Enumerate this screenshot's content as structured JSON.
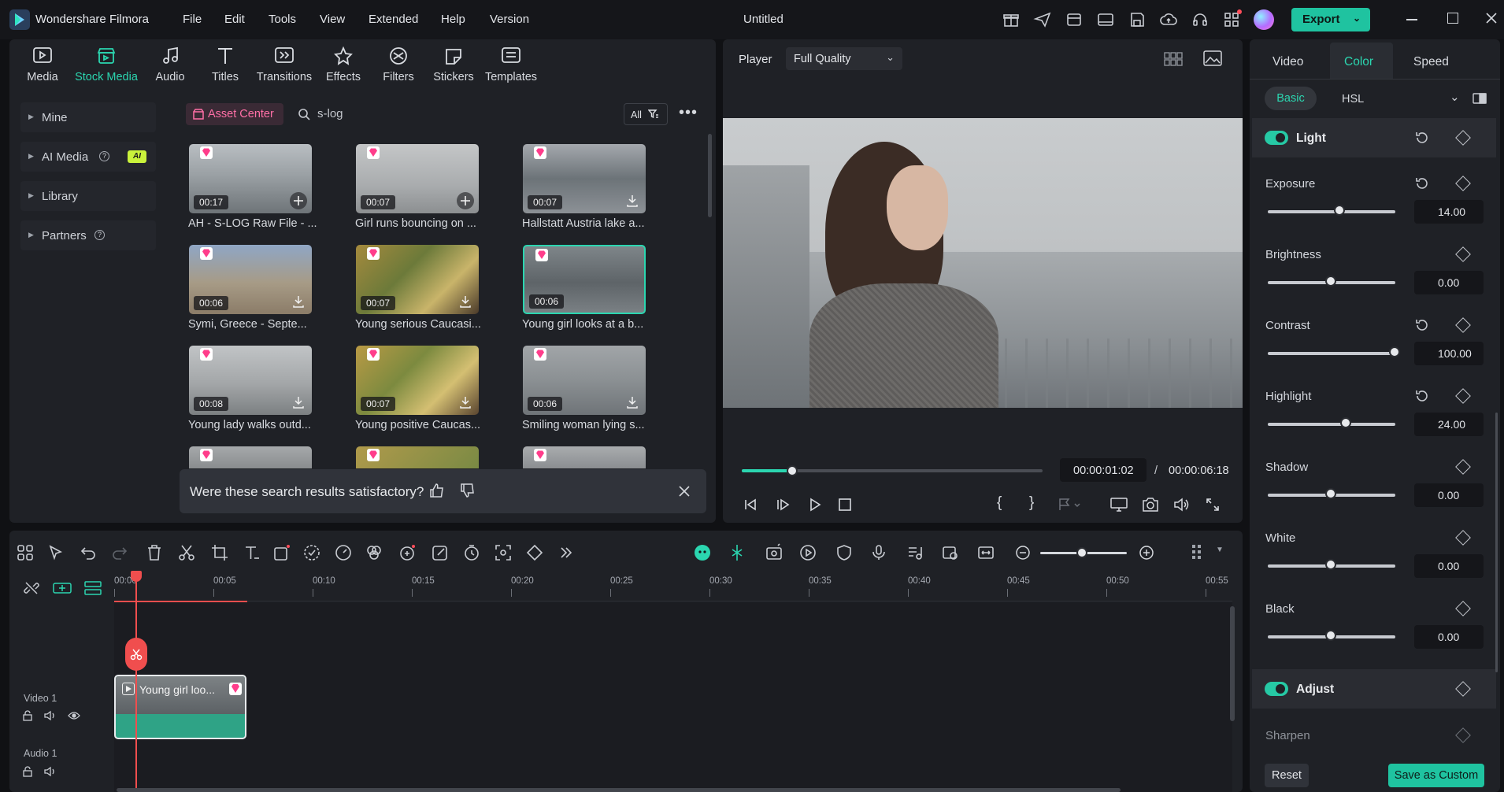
{
  "app": {
    "title": "Wondershare Filmora",
    "project_title": "Untitled",
    "menu": [
      "File",
      "Edit",
      "Tools",
      "View",
      "Extended",
      "Help",
      "Version"
    ],
    "export_label": "Export"
  },
  "media_tabs": [
    {
      "label": "Media",
      "icon": "media-icon"
    },
    {
      "label": "Stock Media",
      "icon": "stock-media-icon"
    },
    {
      "label": "Audio",
      "icon": "audio-icon"
    },
    {
      "label": "Titles",
      "icon": "titles-icon"
    },
    {
      "label": "Transitions",
      "icon": "transitions-icon"
    },
    {
      "label": "Effects",
      "icon": "effects-icon"
    },
    {
      "label": "Filters",
      "icon": "filters-icon"
    },
    {
      "label": "Stickers",
      "icon": "stickers-icon"
    },
    {
      "label": "Templates",
      "icon": "templates-icon"
    }
  ],
  "sidebar": {
    "items": [
      {
        "label": "Mine"
      },
      {
        "label": "AI Media",
        "badge": "AI"
      },
      {
        "label": "Library"
      },
      {
        "label": "Partners"
      }
    ]
  },
  "browser": {
    "asset_center_label": "Asset Center",
    "search_value": "s-log",
    "filter_label": "All",
    "items": [
      {
        "title": "AH - S-LOG Raw File - ...",
        "duration": "00:17",
        "action": "add"
      },
      {
        "title": "Girl runs bouncing on ...",
        "duration": "00:07",
        "action": "add"
      },
      {
        "title": "Hallstatt Austria lake a...",
        "duration": "00:07",
        "action": "download"
      },
      {
        "title": "Symi, Greece - Septe...",
        "duration": "00:06",
        "action": "download"
      },
      {
        "title": "Young serious Caucasi...",
        "duration": "00:07",
        "action": "download"
      },
      {
        "title": "Young girl looks at a b...",
        "duration": "00:06",
        "action": "selected"
      },
      {
        "title": "Young lady walks outd...",
        "duration": "00:08",
        "action": "download"
      },
      {
        "title": "Young positive Caucas...",
        "duration": "00:07",
        "action": "download"
      },
      {
        "title": "Smiling woman lying s...",
        "duration": "00:06",
        "action": "download"
      }
    ],
    "feedback_text": "Were these search results satisfactory?"
  },
  "player": {
    "label": "Player",
    "quality": "Full Quality",
    "current_time": "00:00:01:02",
    "separator": "/",
    "total_time": "00:00:06:18",
    "progress_fraction": 0.17
  },
  "timeline": {
    "ruler": [
      "00:00",
      "00:05",
      "00:10",
      "00:15",
      "00:20",
      "00:25",
      "00:30",
      "00:35",
      "00:40",
      "00:45",
      "00:50",
      "00:55"
    ],
    "tracks": [
      {
        "label": "Video 1"
      },
      {
        "label": "Audio 1"
      }
    ],
    "clip_title": "Young girl loo..."
  },
  "color_panel": {
    "tabs": [
      "Video",
      "Color",
      "Speed"
    ],
    "subtabs": [
      "Basic",
      "HSL"
    ],
    "light_section": "Light",
    "params": [
      {
        "label": "Exposure",
        "value": "14.00",
        "fraction": 0.57
      },
      {
        "label": "Brightness",
        "value": "0.00",
        "fraction": 0.5
      },
      {
        "label": "Contrast",
        "value": "100.00",
        "fraction": 1.0
      },
      {
        "label": "Highlight",
        "value": "24.00",
        "fraction": 0.62
      },
      {
        "label": "Shadow",
        "value": "0.00",
        "fraction": 0.5
      },
      {
        "label": "White",
        "value": "0.00",
        "fraction": 0.5
      },
      {
        "label": "Black",
        "value": "0.00",
        "fraction": 0.5
      }
    ],
    "adjust_section": "Adjust",
    "sharpen_label": "Sharpen",
    "reset_label": "Reset",
    "save_custom_label": "Save as Custom"
  },
  "colors": {
    "accent": "#1fc3a0",
    "gem": "#ff3d8b",
    "playhead": "#f04e4e"
  }
}
